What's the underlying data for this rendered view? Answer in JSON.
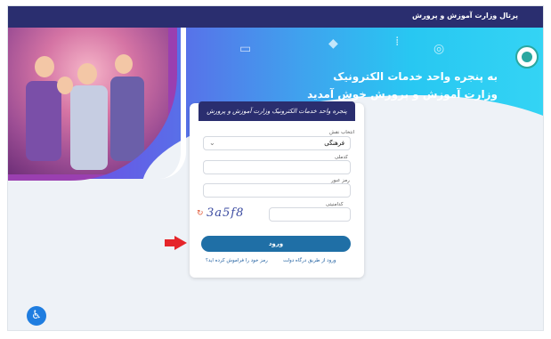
{
  "topbar": {
    "title": "پرتال وزارت آموزش و پرورش"
  },
  "hero": {
    "line1": "به پنجره واحد خدمات الکترونیک",
    "line2": "وزارت آموزش و پرورش خوش آمدید"
  },
  "card": {
    "header": "پنجره واحد خدمات الکترونیک وزارت آموزش و پرورش",
    "role_label": "انتخاب نقش",
    "role_value": "فرهنگی",
    "username_label": "کدملی",
    "password_label": "رمز عبور",
    "captcha_label": "کدامنیتی",
    "captcha_image_text": "3a5f8",
    "login_label": "ورود",
    "gov_link": "ورود از طریق درگاه دولت",
    "forgot_link": "رمز خود را فراموش کرده اید؟"
  },
  "colors": {
    "topbar": "#2a2e6f",
    "button": "#1f6fa6",
    "arrow": "#e5252a",
    "accessibility": "#1f7de0"
  },
  "icons": {
    "accessibility": "accessibility-icon",
    "refresh": "refresh-icon",
    "arrow": "red-arrow-pointer"
  }
}
